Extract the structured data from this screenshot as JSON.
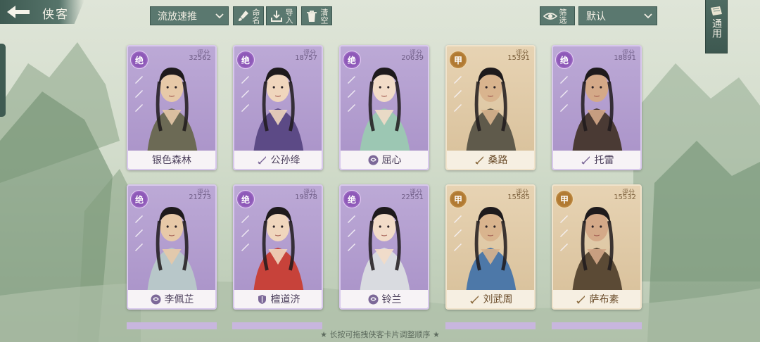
{
  "header": {
    "title": "侠客",
    "formation_select": "流放速推",
    "rename_label": "命名",
    "import_label": "导入",
    "clear_label": "清空",
    "filter_label": "筛选",
    "sort_select": "默认",
    "tong_label": "通用"
  },
  "cards": [
    {
      "grade": "绝",
      "score_label": "评分",
      "score": "32562",
      "name": "银色森林",
      "tier": "jue",
      "faction_icon": "none"
    },
    {
      "grade": "绝",
      "score_label": "评分",
      "score": "18757",
      "name": "公孙绛",
      "tier": "jue",
      "faction_icon": "sword-icon"
    },
    {
      "grade": "绝",
      "score_label": "评分",
      "score": "20639",
      "name": "屈心",
      "tier": "jue",
      "faction_icon": "swirl-icon"
    },
    {
      "grade": "甲",
      "score_label": "评分",
      "score": "15391",
      "name": "桑路",
      "tier": "jia",
      "faction_icon": "sword-icon"
    },
    {
      "grade": "绝",
      "score_label": "评分",
      "score": "18891",
      "name": "托雷",
      "tier": "jue",
      "faction_icon": "sword-icon"
    },
    {
      "grade": "绝",
      "score_label": "评分",
      "score": "21273",
      "name": "李佩芷",
      "tier": "jue",
      "faction_icon": "swirl-icon"
    },
    {
      "grade": "绝",
      "score_label": "评分",
      "score": "19878",
      "name": "檀道济",
      "tier": "jue",
      "faction_icon": "shield-icon"
    },
    {
      "grade": "绝",
      "score_label": "评分",
      "score": "22551",
      "name": "铃兰",
      "tier": "jue",
      "faction_icon": "swirl-icon"
    },
    {
      "grade": "甲",
      "score_label": "评分",
      "score": "15585",
      "name": "刘武周",
      "tier": "jia",
      "faction_icon": "sword-icon"
    },
    {
      "grade": "甲",
      "score_label": "评分",
      "score": "15532",
      "name": "萨布素",
      "tier": "jia",
      "faction_icon": "sword-icon"
    }
  ],
  "footer": {
    "tip": "★ 长按可拖拽侠客卡片调整顺序 ★"
  },
  "colors": {
    "jue_purple": "#a992c8",
    "jia_gold": "#d8c09a",
    "button_green": "#5a786f"
  }
}
